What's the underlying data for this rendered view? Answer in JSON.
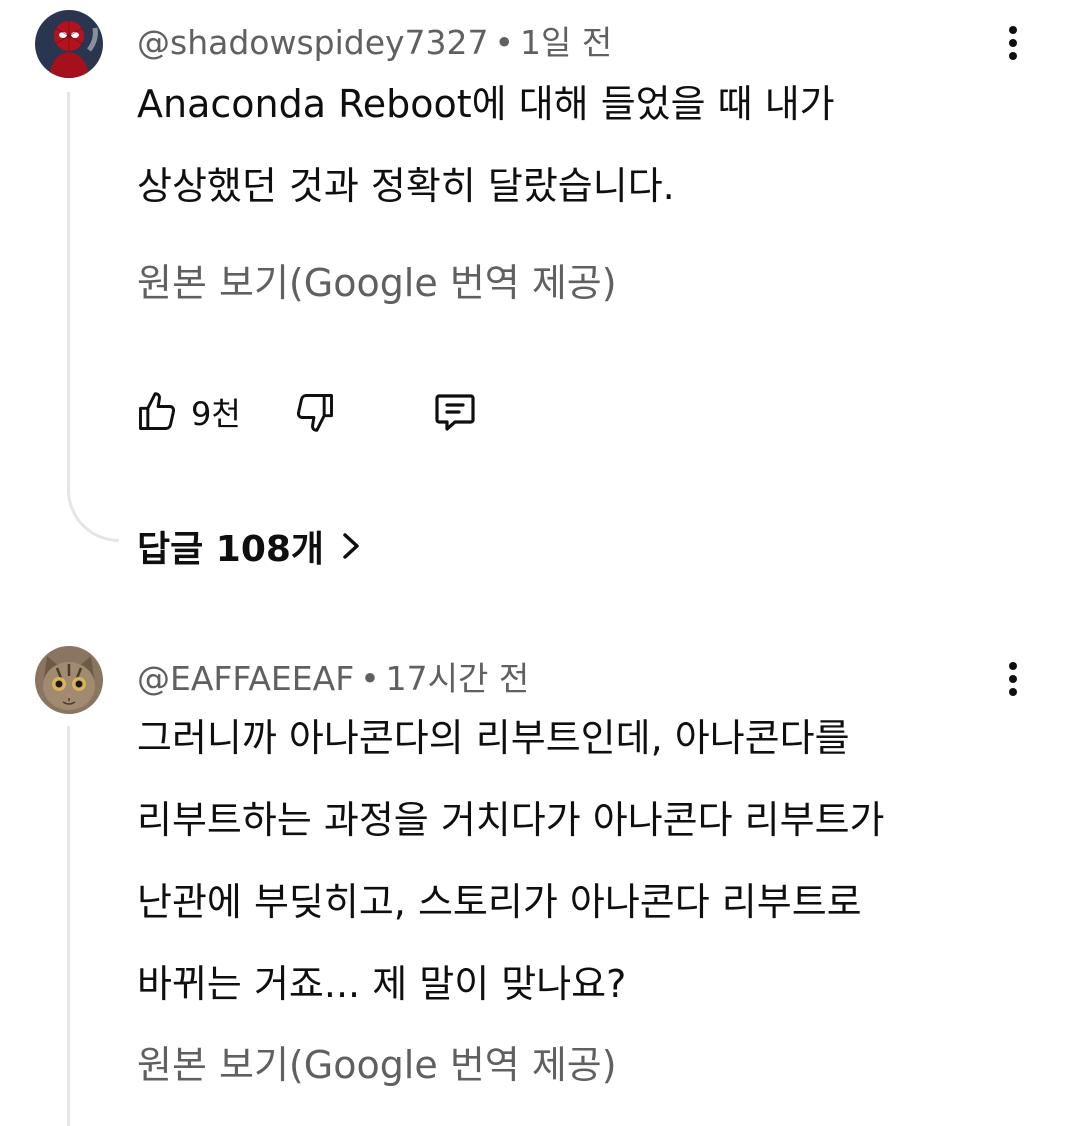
{
  "comments": [
    {
      "username": "@shadowspidey7327",
      "time": "1일 전",
      "text_lines": [
        "Anaconda Reboot에 대해 들었을 때 내가",
        "상상했던 것과 정확히 달랐습니다."
      ],
      "translate_label": "원본 보기(Google 번역 제공)",
      "likes": "9천",
      "replies_label": "답글 108개"
    },
    {
      "username": "@EAFFAEEAF",
      "time": "17시간 전",
      "text_lines": [
        "그러니까 아나콘다의 리부트인데, 아나콘다를",
        "리부트하는 과정을 거치다가 아나콘다 리부트가",
        "난관에 부딪히고, 스토리가 아나콘다 리부트로",
        "바뀌는 거죠... 제 말이 맞나요?"
      ],
      "translate_label": "원본 보기(Google 번역 제공)"
    }
  ],
  "separator": "•",
  "icons": {
    "like": "thumbs-up-icon",
    "dislike": "thumbs-down-icon",
    "reply": "comment-icon",
    "more": "more-vertical-icon",
    "chevron": "chevron-right-icon"
  }
}
